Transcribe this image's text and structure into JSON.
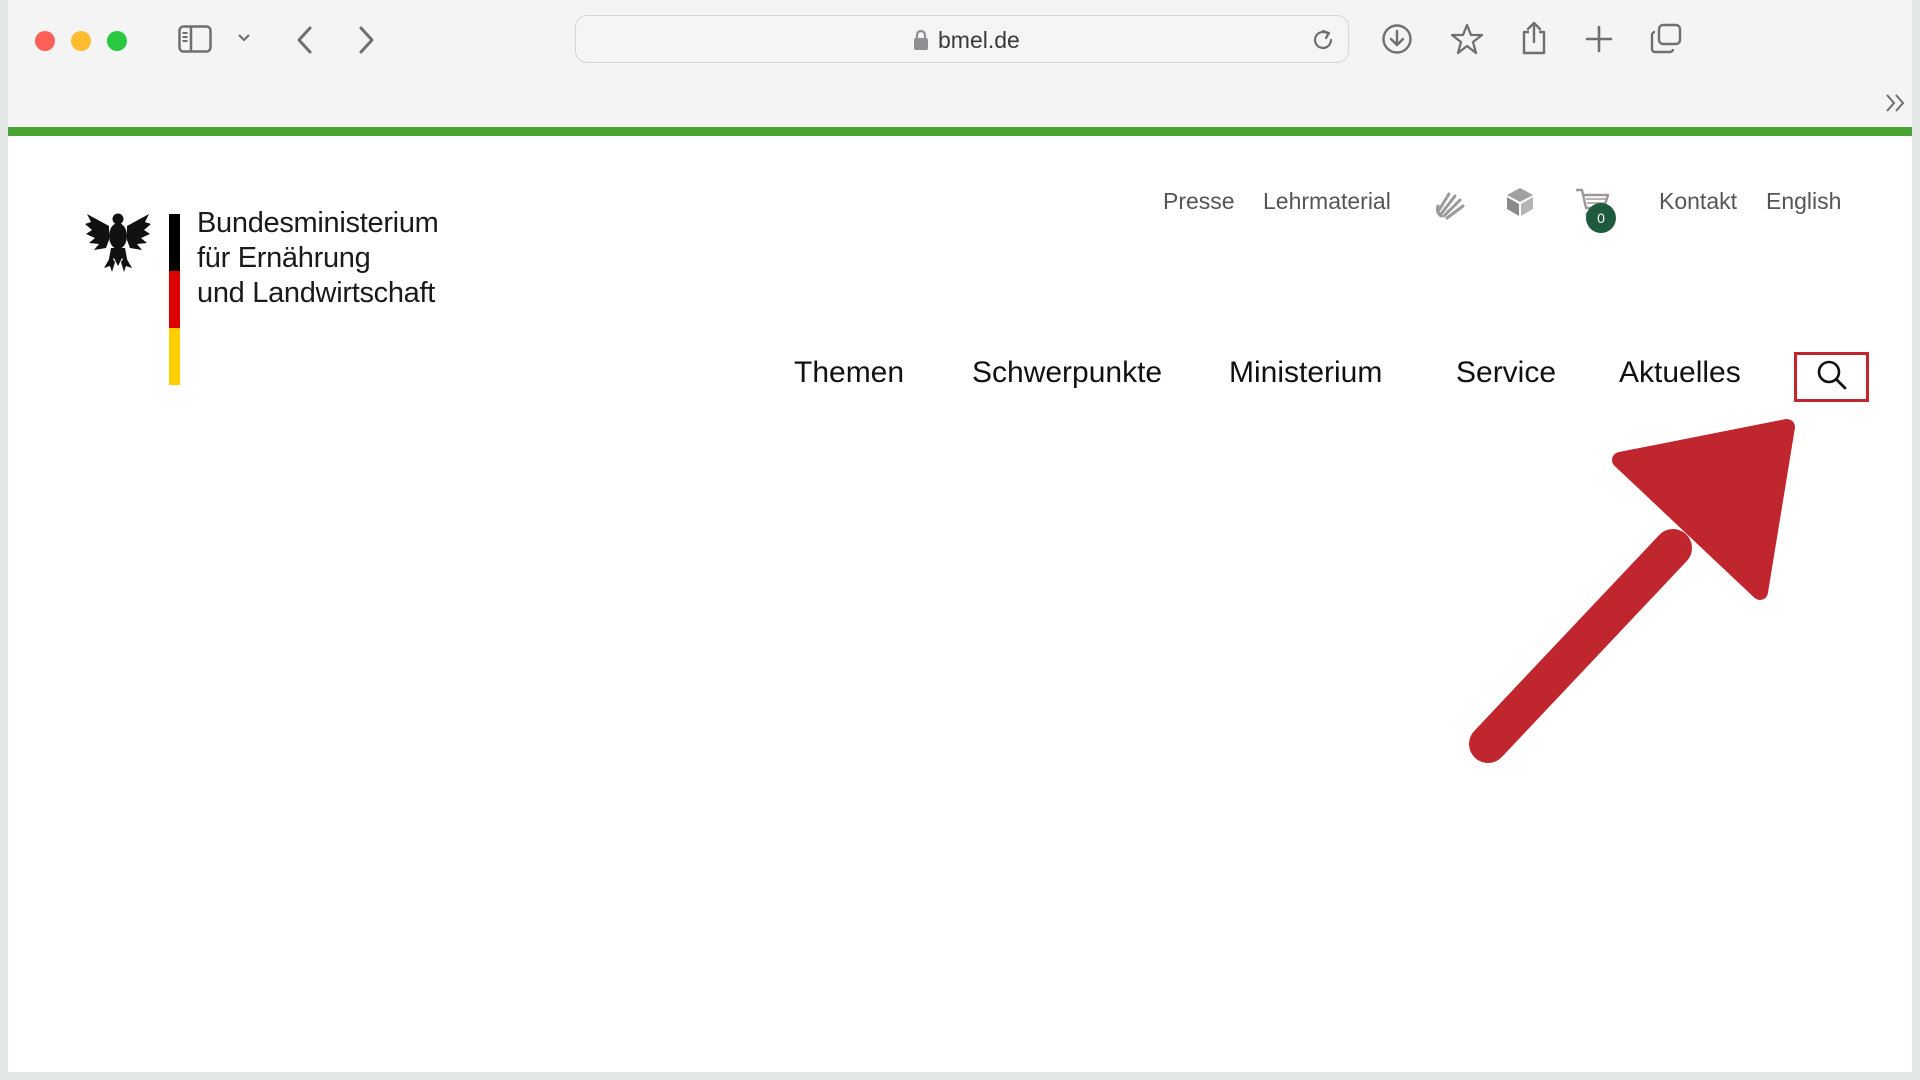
{
  "browser": {
    "url": "bmel.de"
  },
  "logo": {
    "lines": [
      "Bundesministerium",
      "für Ernährung",
      "und Landwirtschaft"
    ],
    "flag_colors": [
      "#000000",
      "#dd0000",
      "#ffce00"
    ]
  },
  "meta_nav": {
    "presse": "Presse",
    "lehrmaterial": "Lehrmaterial",
    "cart_count": "0",
    "kontakt": "Kontakt",
    "english": "English"
  },
  "main_nav": {
    "items": [
      "Themen",
      "Schwerpunkte",
      "Ministerium",
      "Service",
      "Aktuelles"
    ]
  },
  "colors": {
    "accent_green": "#4aa534",
    "highlight_red": "#c0262e",
    "badge_green": "#1e5b3e"
  }
}
